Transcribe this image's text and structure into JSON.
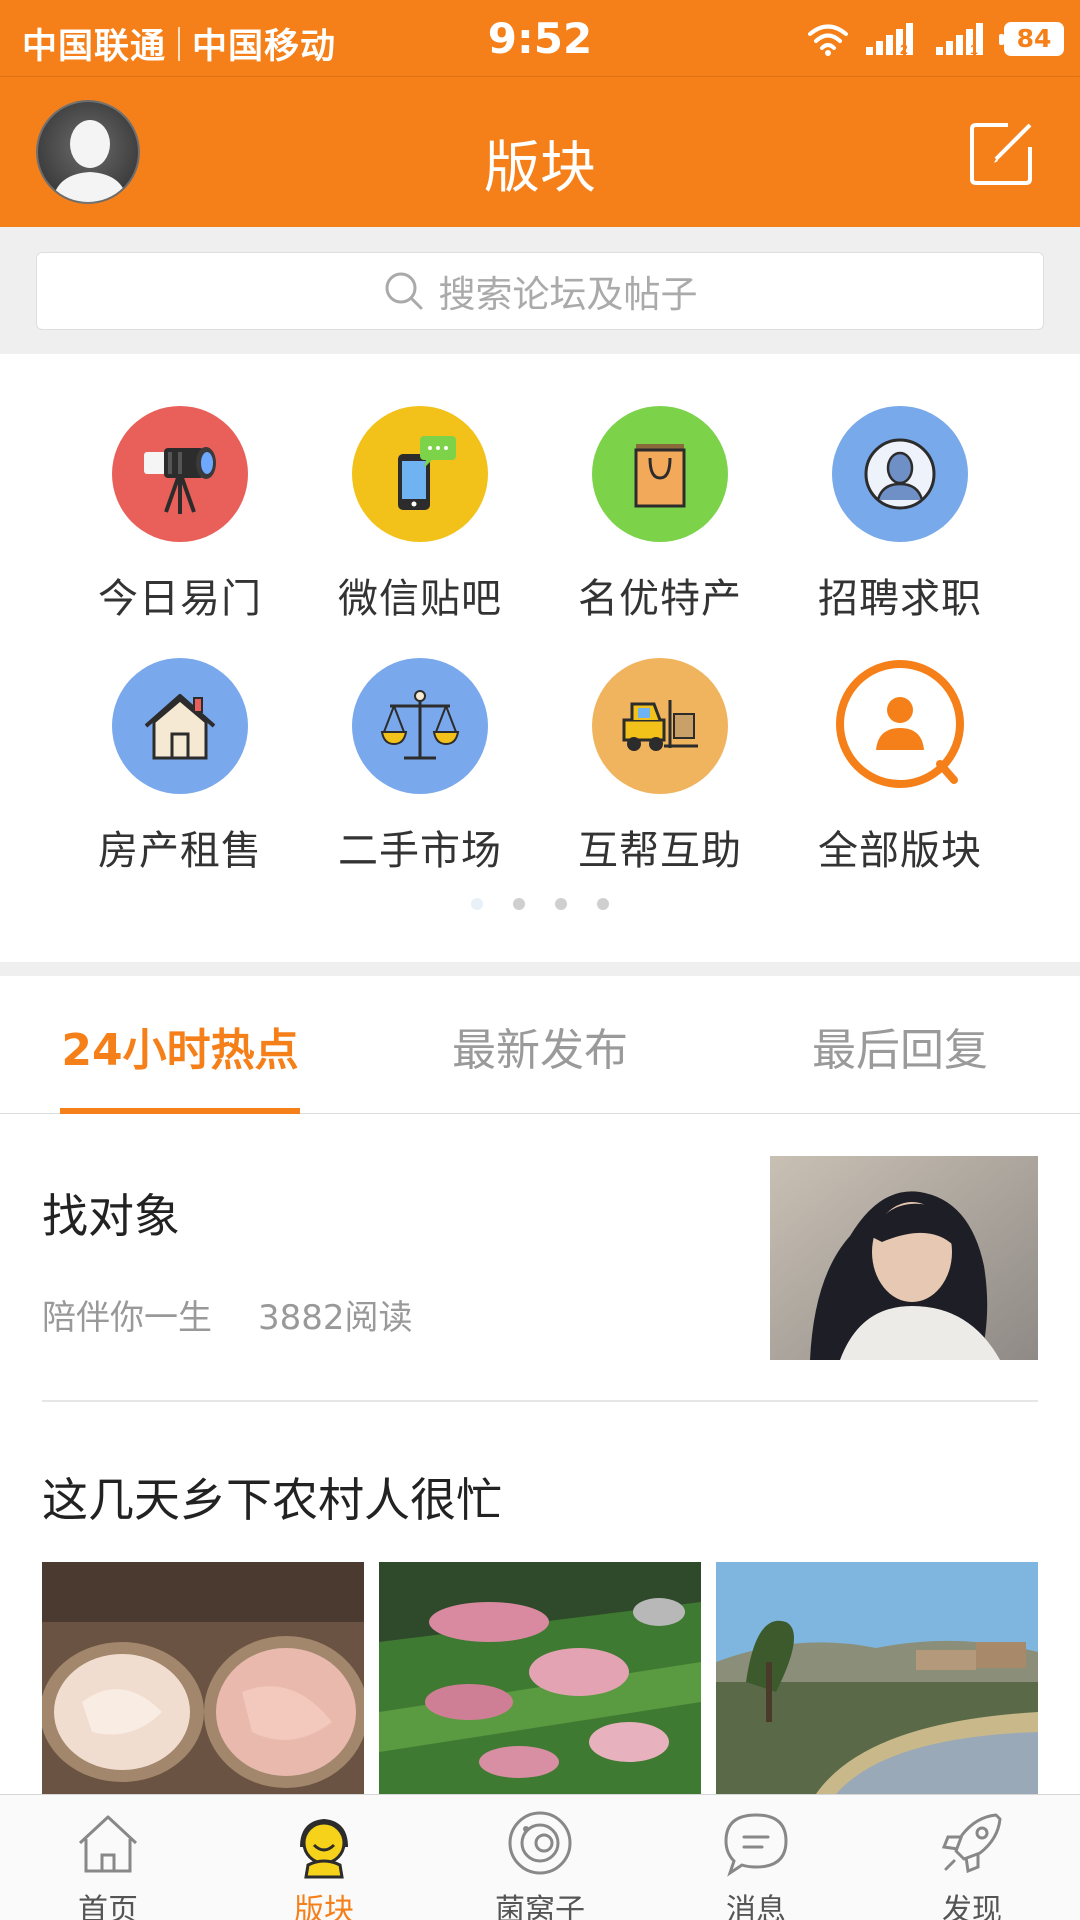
{
  "status_bar": {
    "carrier1": "中国联通",
    "carrier2": "中国移动",
    "time": "9:52",
    "battery": "84",
    "sim1": "2",
    "sim2": "1"
  },
  "header": {
    "title": "版块",
    "avatar_icon": "user-avatar",
    "compose_icon": "edit-icon"
  },
  "search": {
    "placeholder": "搜索论坛及帖子"
  },
  "categories": [
    {
      "label": "今日易门",
      "icon": "camera-icon",
      "color": "#e9605a"
    },
    {
      "label": "微信贴吧",
      "icon": "phone-chat-icon",
      "color": "#f2c11a"
    },
    {
      "label": "名优特产",
      "icon": "shopping-bag-icon",
      "color": "#7cd34a"
    },
    {
      "label": "招聘求职",
      "icon": "person-icon",
      "color": "#78a9ea"
    },
    {
      "label": "房产租售",
      "icon": "house-icon",
      "color": "#7aa8ec"
    },
    {
      "label": "二手市场",
      "icon": "scale-icon",
      "color": "#7aa8ec"
    },
    {
      "label": "互帮互助",
      "icon": "forklift-icon",
      "color": "#f1b45e"
    },
    {
      "label": "全部版块",
      "icon": "search-person-icon",
      "color": "#f5801a"
    }
  ],
  "pager": {
    "count": 4,
    "active": 0
  },
  "tabs": [
    {
      "label": "24小时热点",
      "active": true
    },
    {
      "label": "最新发布",
      "active": false
    },
    {
      "label": "最后回复",
      "active": false
    }
  ],
  "feed": {
    "post1": {
      "title": "找对象",
      "board": "陪伴你一生",
      "reads": "3882阅读"
    },
    "post2": {
      "title": "这几天乡下农村人很忙"
    }
  },
  "bottom_nav": [
    {
      "label": "首页",
      "icon": "home-icon",
      "active": false
    },
    {
      "label": "版块",
      "icon": "board-face-icon",
      "active": true
    },
    {
      "label": "菌窝子",
      "icon": "planet-icon",
      "active": false
    },
    {
      "label": "消息",
      "icon": "message-icon",
      "active": false
    },
    {
      "label": "发现",
      "icon": "rocket-icon",
      "active": false
    }
  ],
  "colors": {
    "brand": "#f5801a",
    "text": "#222222",
    "muted": "#999999"
  }
}
